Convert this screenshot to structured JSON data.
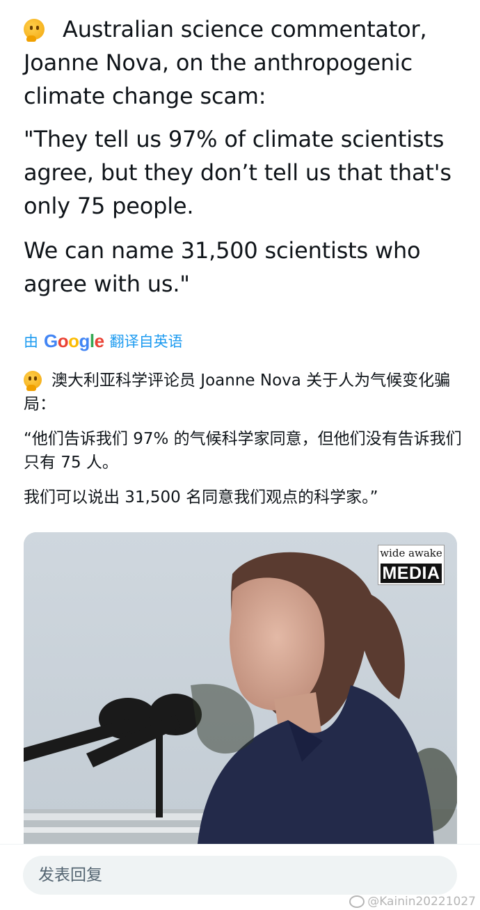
{
  "tweet": {
    "original": {
      "intro": "Australian science commentator, Joanne Nova, on the anthropogenic climate change scam:",
      "quote_part1": "\"They tell us 97% of climate scientists agree, but they don’t tell us that that's only 75 people.",
      "quote_part2": "We can name 31,500 scientists who agree with us.\""
    },
    "translated_by": {
      "prefix": "由",
      "brand": "Google",
      "suffix": "翻译自英语"
    },
    "translation": {
      "intro": "澳大利亚科学评论员 Joanne Nova 关于人为气候变化骗局：",
      "quote_part1": "“他们告诉我们 97% 的气候科学家同意，但他们没有告诉我们只有 75 人。",
      "quote_part2": "我们可以说出 31,500 名同意我们观点的科学家。”"
    },
    "media": {
      "watermark_top": "wide awake",
      "watermark_bottom": "MEDIA"
    }
  },
  "reply": {
    "placeholder": "发表回复"
  },
  "footer": {
    "watermark": "@Kainin20221027"
  },
  "icons": {
    "emoji": "thinking-face-icon",
    "weibo": "weibo-icon"
  },
  "colors": {
    "link": "#1d9bf0",
    "text": "#0f1419",
    "input_bg": "#eff3f4"
  }
}
